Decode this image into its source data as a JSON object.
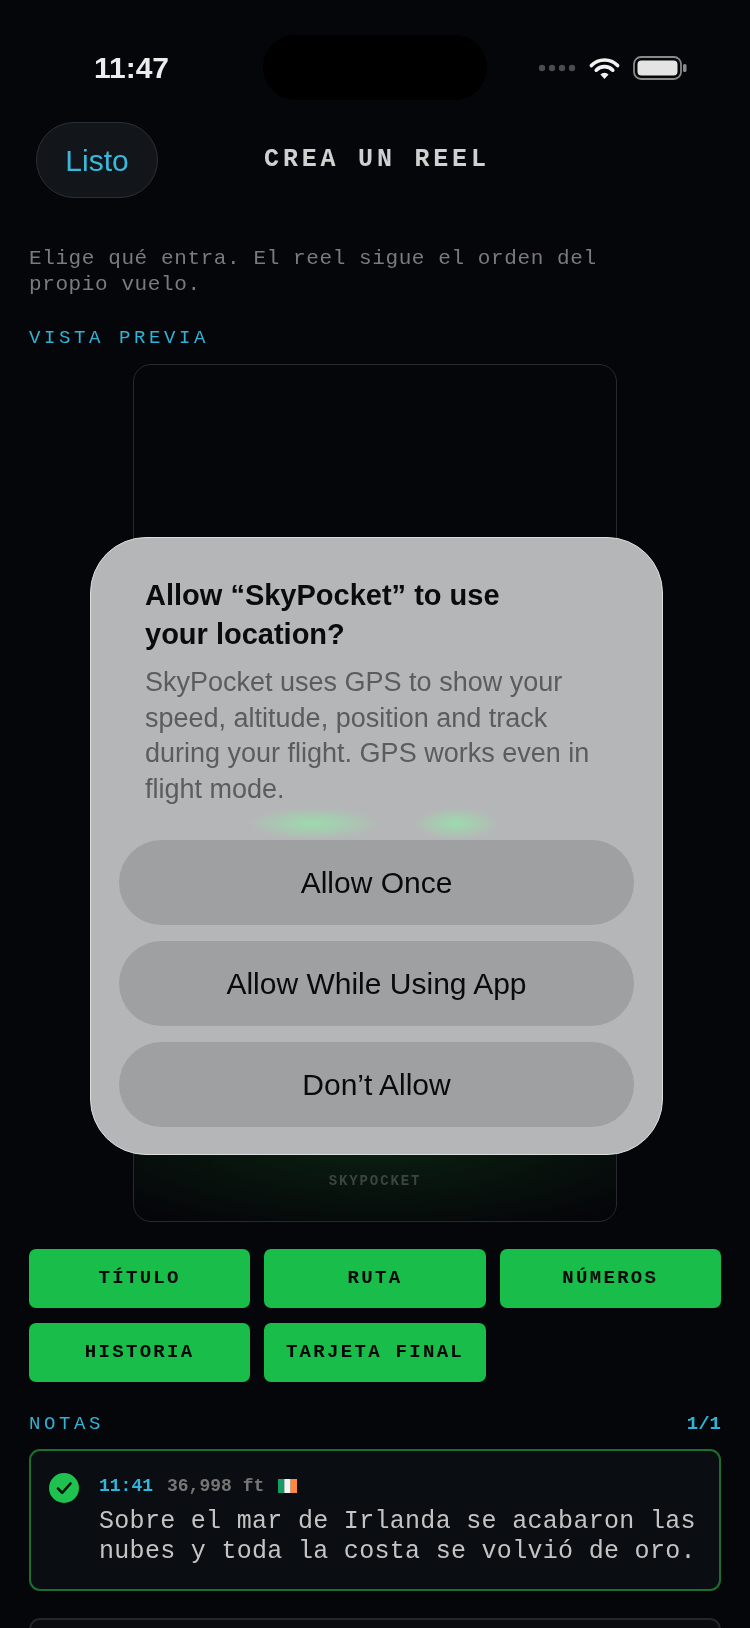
{
  "status_bar": {
    "time": "11:47"
  },
  "nav": {
    "done_button": "Listo",
    "title": "CREA UN REEL"
  },
  "intro": "Elige qué entra. El reel sigue el orden del propio vuelo.",
  "preview": {
    "label": "VISTA PREVIA",
    "footer": "SKYPOCKET"
  },
  "sections": [
    {
      "label": "TÍTULO",
      "on": true
    },
    {
      "label": "RUTA",
      "on": true
    },
    {
      "label": "NÚMEROS",
      "on": true
    },
    {
      "label": "HISTORIA",
      "on": true
    },
    {
      "label": "TARJETA FINAL",
      "on": true
    }
  ],
  "notes": {
    "label": "NOTAS",
    "count": "1/1",
    "items": [
      {
        "checked": true,
        "time": "11:41",
        "altitude": "36,998 ft",
        "text": "Sobre el mar de Irlanda se acabaron las nubes y toda la costa se volvió de oro."
      }
    ]
  },
  "alert": {
    "title": "Allow “SkyPocket” to use your location?",
    "message": "SkyPocket uses GPS to show your speed, altitude, position and track during your flight. GPS works even in flight mode.",
    "buttons": [
      "Allow Once",
      "Allow While Using App",
      "Don’t Allow"
    ]
  }
}
